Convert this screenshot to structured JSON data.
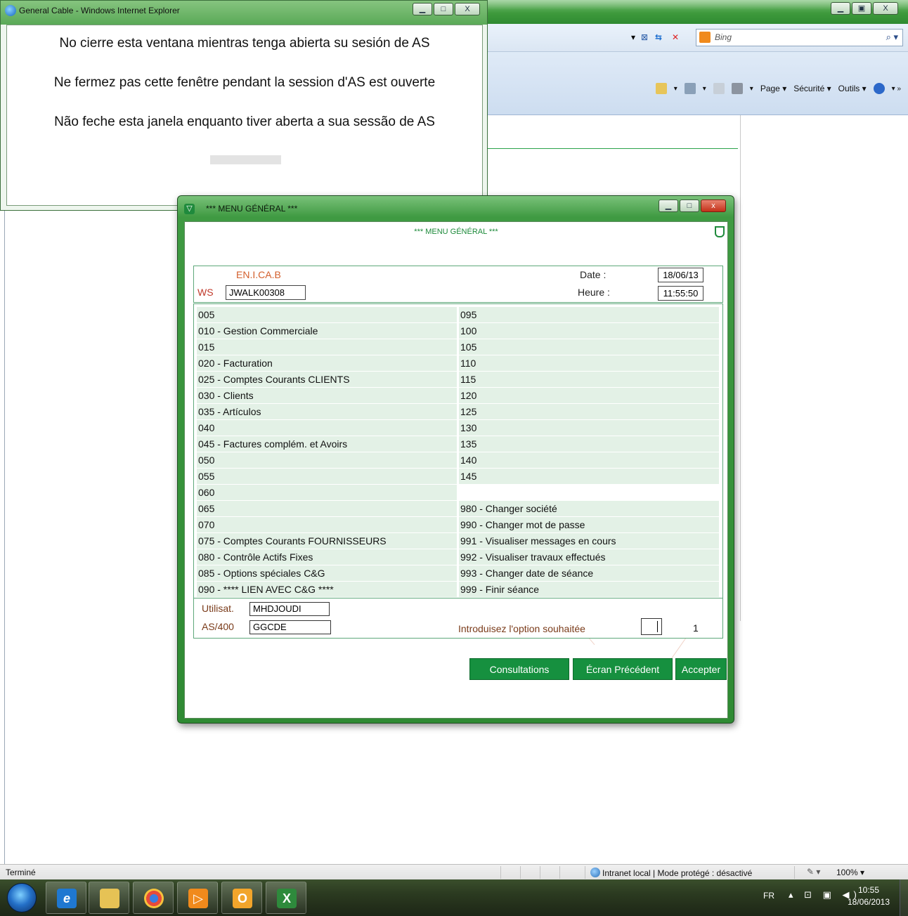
{
  "popup": {
    "title": "General Cable - Windows Internet Explorer",
    "messages": [
      "No cierre esta ventana mientras tenga abierta su sesión de AS",
      "Ne fermez pas cette fenêtre pendant la session d'AS est ouverte",
      "Não feche esta janela enquanto tiver aberta a sua sessão de AS"
    ]
  },
  "ie": {
    "search_placeholder": "Bing",
    "commands": [
      "Page ▾",
      "Sécurité ▾",
      "Outils ▾"
    ]
  },
  "menu": {
    "window_title": "*** MENU GÉNÉRAL ***",
    "header_title": "*** MENU GÉNÉRAL ***",
    "company": "EN.I.CA.B",
    "ws_label": "WS",
    "ws_value": "JWALK00308",
    "date_label": "Date :",
    "date_value": "18/06/13",
    "hour_label": "Heure :",
    "hour_value": "11:55:50",
    "left_options": [
      "005",
      "010 - Gestion Commerciale",
      "015",
      "020 - Facturation",
      "025 - Comptes Courants CLIENTS",
      "030 - Clients",
      "035 - Artículos",
      "040",
      "045 - Factures complém. et Avoirs",
      "050",
      "055",
      "060",
      "065",
      "070",
      "075 - Comptes Courants FOURNISSEURS",
      "080 - Contrôle Actifs Fixes",
      "085 - Options spéciales C&G",
      "090 -      **** LIEN AVEC C&G ****"
    ],
    "right_options": [
      "095",
      "100",
      "105",
      "110",
      "115",
      "120",
      "125",
      "130",
      "135",
      "140",
      "145",
      "",
      "980 - Changer société",
      "990 - Changer mot de passe",
      "991 - Visualiser messages en cours",
      "992 - Visualiser travaux effectués",
      "993 - Changer date de séance",
      "999 - Finir séance"
    ],
    "user_label": "Utilisat.",
    "user_value": "MHDJOUDI",
    "as400_label": "AS/400",
    "as400_value": "GGCDE",
    "option_prompt": "Introduisez l'option souhaitée",
    "option_count": "1",
    "buttons": {
      "consultations": "Consultations",
      "previous": "Écran Précédent",
      "accept": "Accepter"
    }
  },
  "statusbar": {
    "status": "Terminé",
    "zone": "Intranet local | Mode protégé : désactivé",
    "zoom": "100%  ▾"
  },
  "taskbar": {
    "lang": "FR",
    "time": "10:55",
    "date": "18/06/2013"
  },
  "colors": {
    "accent_green": "#16903f",
    "row_bg": "#e3f1e6",
    "label_brown": "#7a3b1a",
    "company_orange": "#d35f2c"
  }
}
